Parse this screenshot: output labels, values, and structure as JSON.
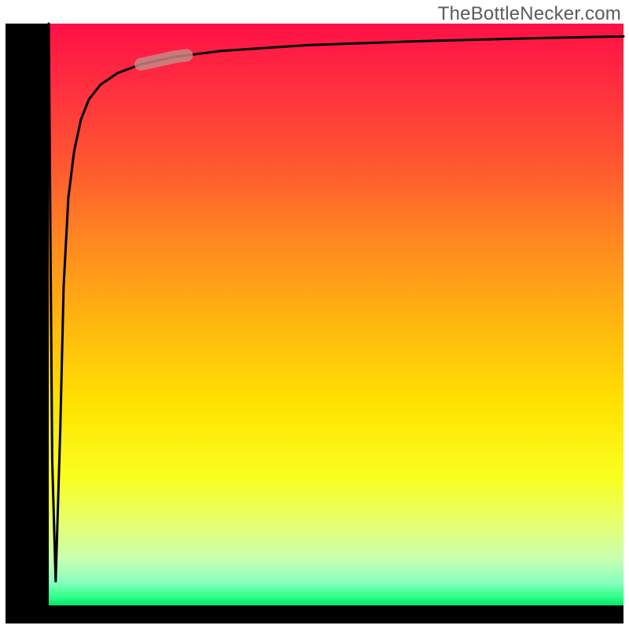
{
  "attribution": "TheBottleNecker.com",
  "colors": {
    "frame": "#000000",
    "highlight": "#c68b86",
    "curve": "#000000"
  },
  "chart_data": {
    "type": "line",
    "title": "",
    "xlabel": "",
    "ylabel": "",
    "xlim": [
      0,
      100
    ],
    "ylim": [
      0,
      100
    ],
    "series": [
      {
        "name": "curve",
        "x": [
          0,
          0.6,
          1.2,
          2.0,
          2.6,
          3.4,
          4.4,
          5.6,
          7.0,
          9.0,
          12.0,
          16.0,
          22.0,
          30.0,
          45.0,
          65.0,
          85.0,
          100.0
        ],
        "values": [
          100,
          25,
          4,
          30,
          55,
          70,
          78,
          83.5,
          87,
          89.5,
          91.5,
          93,
          94.3,
          95.3,
          96.3,
          97.0,
          97.5,
          97.8
        ]
      }
    ],
    "highlight_segment": {
      "x_start": 16,
      "x_end": 24
    },
    "background_gradient": [
      "#ff1046",
      "#ffb80f",
      "#faff20",
      "#00e868"
    ]
  }
}
